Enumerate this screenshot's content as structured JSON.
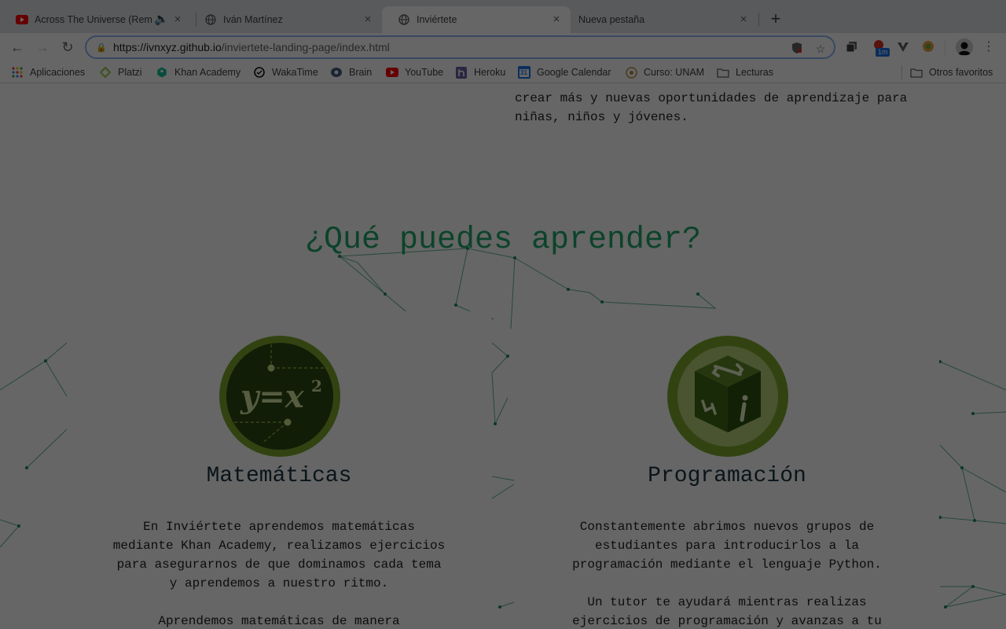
{
  "tabs": [
    {
      "title": "Across The Universe (Rem",
      "icon": "youtube-icon",
      "audio": true,
      "active": false
    },
    {
      "title": "Iván Martínez",
      "icon": "globe-icon",
      "active": false
    },
    {
      "title": "Inviértete",
      "icon": "globe-icon",
      "active": true
    },
    {
      "title": "Nueva pestaña",
      "icon": "none",
      "active": false
    }
  ],
  "omnibox": {
    "host": "https://ivnxyz.github.io",
    "path": "/inviertete-landing-page/index.html"
  },
  "bookmarks": [
    {
      "label": "Aplicaciones",
      "icon": "apps-grid-icon"
    },
    {
      "label": "Platzi",
      "icon": "platzi-icon"
    },
    {
      "label": "Khan Academy",
      "icon": "khan-academy-icon"
    },
    {
      "label": "WakaTime",
      "icon": "wakatime-icon"
    },
    {
      "label": "Brain",
      "icon": "brain-icon"
    },
    {
      "label": "YouTube",
      "icon": "youtube-icon"
    },
    {
      "label": "Heroku",
      "icon": "heroku-icon"
    },
    {
      "label": "Google Calendar",
      "icon": "calendar-icon"
    },
    {
      "label": "Curso: UNAM",
      "icon": "unam-icon"
    },
    {
      "label": "Lecturas",
      "icon": "folder-icon"
    }
  ],
  "other_bookmarks": "Otros favoritos",
  "extensions": {
    "badge": "1m",
    "calendar_day": "31"
  },
  "page": {
    "intro_tail": "crear más y nuevas oportunidades de aprendizaje para\nniñas, niños y jóvenes.",
    "section_title": "¿Qué puedes aprender?",
    "cards": [
      {
        "title": "Matemáticas",
        "icon": "math-equation-icon",
        "equation": "y=x²",
        "text": "En Inviértete aprendemos matemáticas\nmediante Khan Academy, realizamos ejercicios\npara asegurarnos de que dominamos cada tema\ny aprendemos a nuestro ritmo.\n\nAprendemos matemáticas de manera"
      },
      {
        "title": "Programación",
        "icon": "code-cube-icon",
        "text": "Constantemente abrimos nuevos grupos de\nestudiantes para introducirlos a la\nprogramación mediante el lenguaje Python.\n\nUn tutor te ayudará mientras realizas\nejercicios de programación y avanzas a tu"
      }
    ]
  },
  "colors": {
    "accent_green": "#1fa86a",
    "heading_dark": "#1a3240",
    "icon_olive": "#7ea82c",
    "overlay": "rgba(0,0,0,0.6)"
  }
}
